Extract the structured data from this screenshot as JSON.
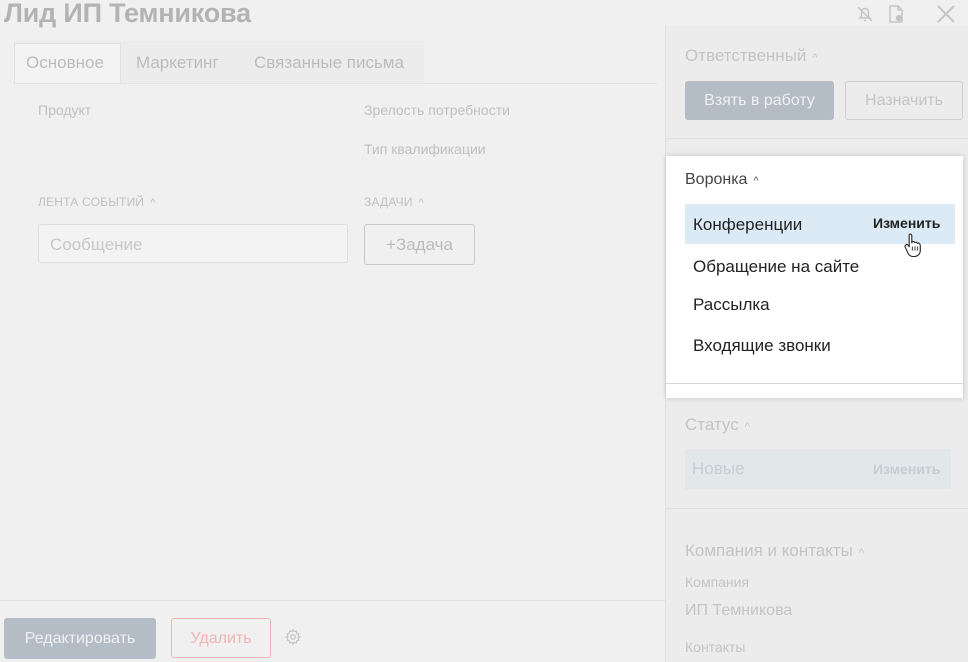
{
  "header": {
    "title": "Лид ИП Темникова",
    "icons": [
      "bell-off-icon",
      "document-icon",
      "close-icon"
    ]
  },
  "tabs": [
    {
      "label": "Основное",
      "active": true
    },
    {
      "label": "Маркетинг",
      "active": false
    },
    {
      "label": "Связанные письма",
      "active": false
    }
  ],
  "fields": {
    "product": "Продукт",
    "maturity": "Зрелость потребности",
    "qualification_type": "Тип квалификации"
  },
  "events": {
    "section_label": "ЛЕНТА СОБЫТИЙ",
    "message_placeholder": "Сообщение"
  },
  "tasks": {
    "section_label": "ЗАДАЧИ",
    "add_label": "+Задача"
  },
  "footer": {
    "edit_label": "Редактировать",
    "delete_label": "Удалить"
  },
  "sidebar": {
    "responsible": {
      "label": "Ответственный",
      "take_label": "Взять в работу",
      "assign_label": "Назначить"
    },
    "status": {
      "label": "Статус",
      "value": "Новые",
      "change_label": "Изменить"
    },
    "company": {
      "label": "Компания и контакты",
      "company_label": "Компания",
      "company_value": "ИП Темникова",
      "contacts_label": "Контакты"
    }
  },
  "funnel_dropdown": {
    "title": "Воронка",
    "change_label": "Изменить",
    "items": [
      "Конференции",
      "Обращение на сайте",
      "Рассылка",
      "Входящие звонки"
    ],
    "highlighted": "Конференции"
  },
  "colors": {
    "primary_button": "#b4bcc6",
    "danger": "#f0b4b4",
    "highlight": "#dbeaf5"
  }
}
